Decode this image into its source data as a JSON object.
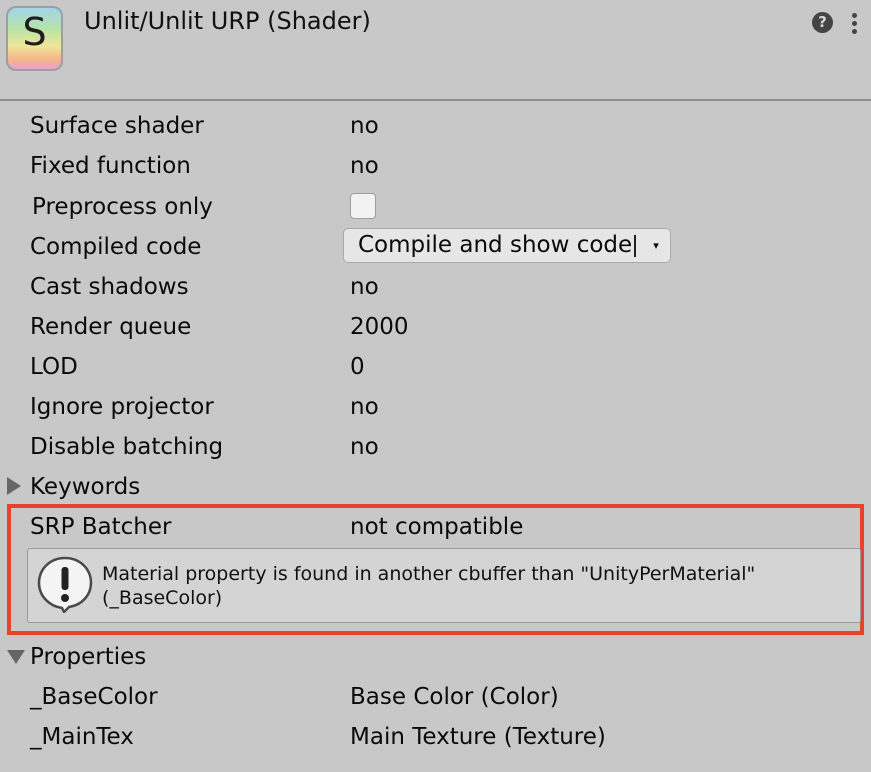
{
  "header": {
    "icon_letter": "S",
    "title": "Unlit/Unlit URP (Shader)",
    "help_symbol": "?"
  },
  "properties": {
    "surface_shader": {
      "label": "Surface shader",
      "value": "no"
    },
    "fixed_function": {
      "label": "Fixed function",
      "value": "no"
    },
    "preprocess_only": {
      "label": "Preprocess only",
      "checked": false
    },
    "compiled_code": {
      "label": "Compiled code",
      "button": "Compile and show code",
      "arrow": "▾"
    },
    "cast_shadows": {
      "label": "Cast shadows",
      "value": "no"
    },
    "render_queue": {
      "label": "Render queue",
      "value": "2000"
    },
    "lod": {
      "label": "LOD",
      "value": "0"
    },
    "ignore_projector": {
      "label": "Ignore projector",
      "value": "no"
    },
    "disable_batching": {
      "label": "Disable batching",
      "value": "no"
    }
  },
  "keywords": {
    "label": "Keywords",
    "expanded": false
  },
  "srp_batcher": {
    "label": "SRP Batcher",
    "value": "not compatible",
    "message_line1": "Material property is found in another cbuffer than \"UnityPerMaterial\"",
    "message_line2": "(_BaseColor)",
    "highlight_color": "#e8412e"
  },
  "shader_properties": {
    "label": "Properties",
    "expanded": true,
    "items": [
      {
        "name": "_BaseColor",
        "description": "Base Color (Color)"
      },
      {
        "name": "_MainTex",
        "description": "Main Texture (Texture)"
      }
    ]
  },
  "icons": [
    "shader-icon",
    "help-icon",
    "more-menu-icon",
    "foldout-arrow-icon",
    "warning-icon",
    "dropdown-arrow-icon"
  ]
}
